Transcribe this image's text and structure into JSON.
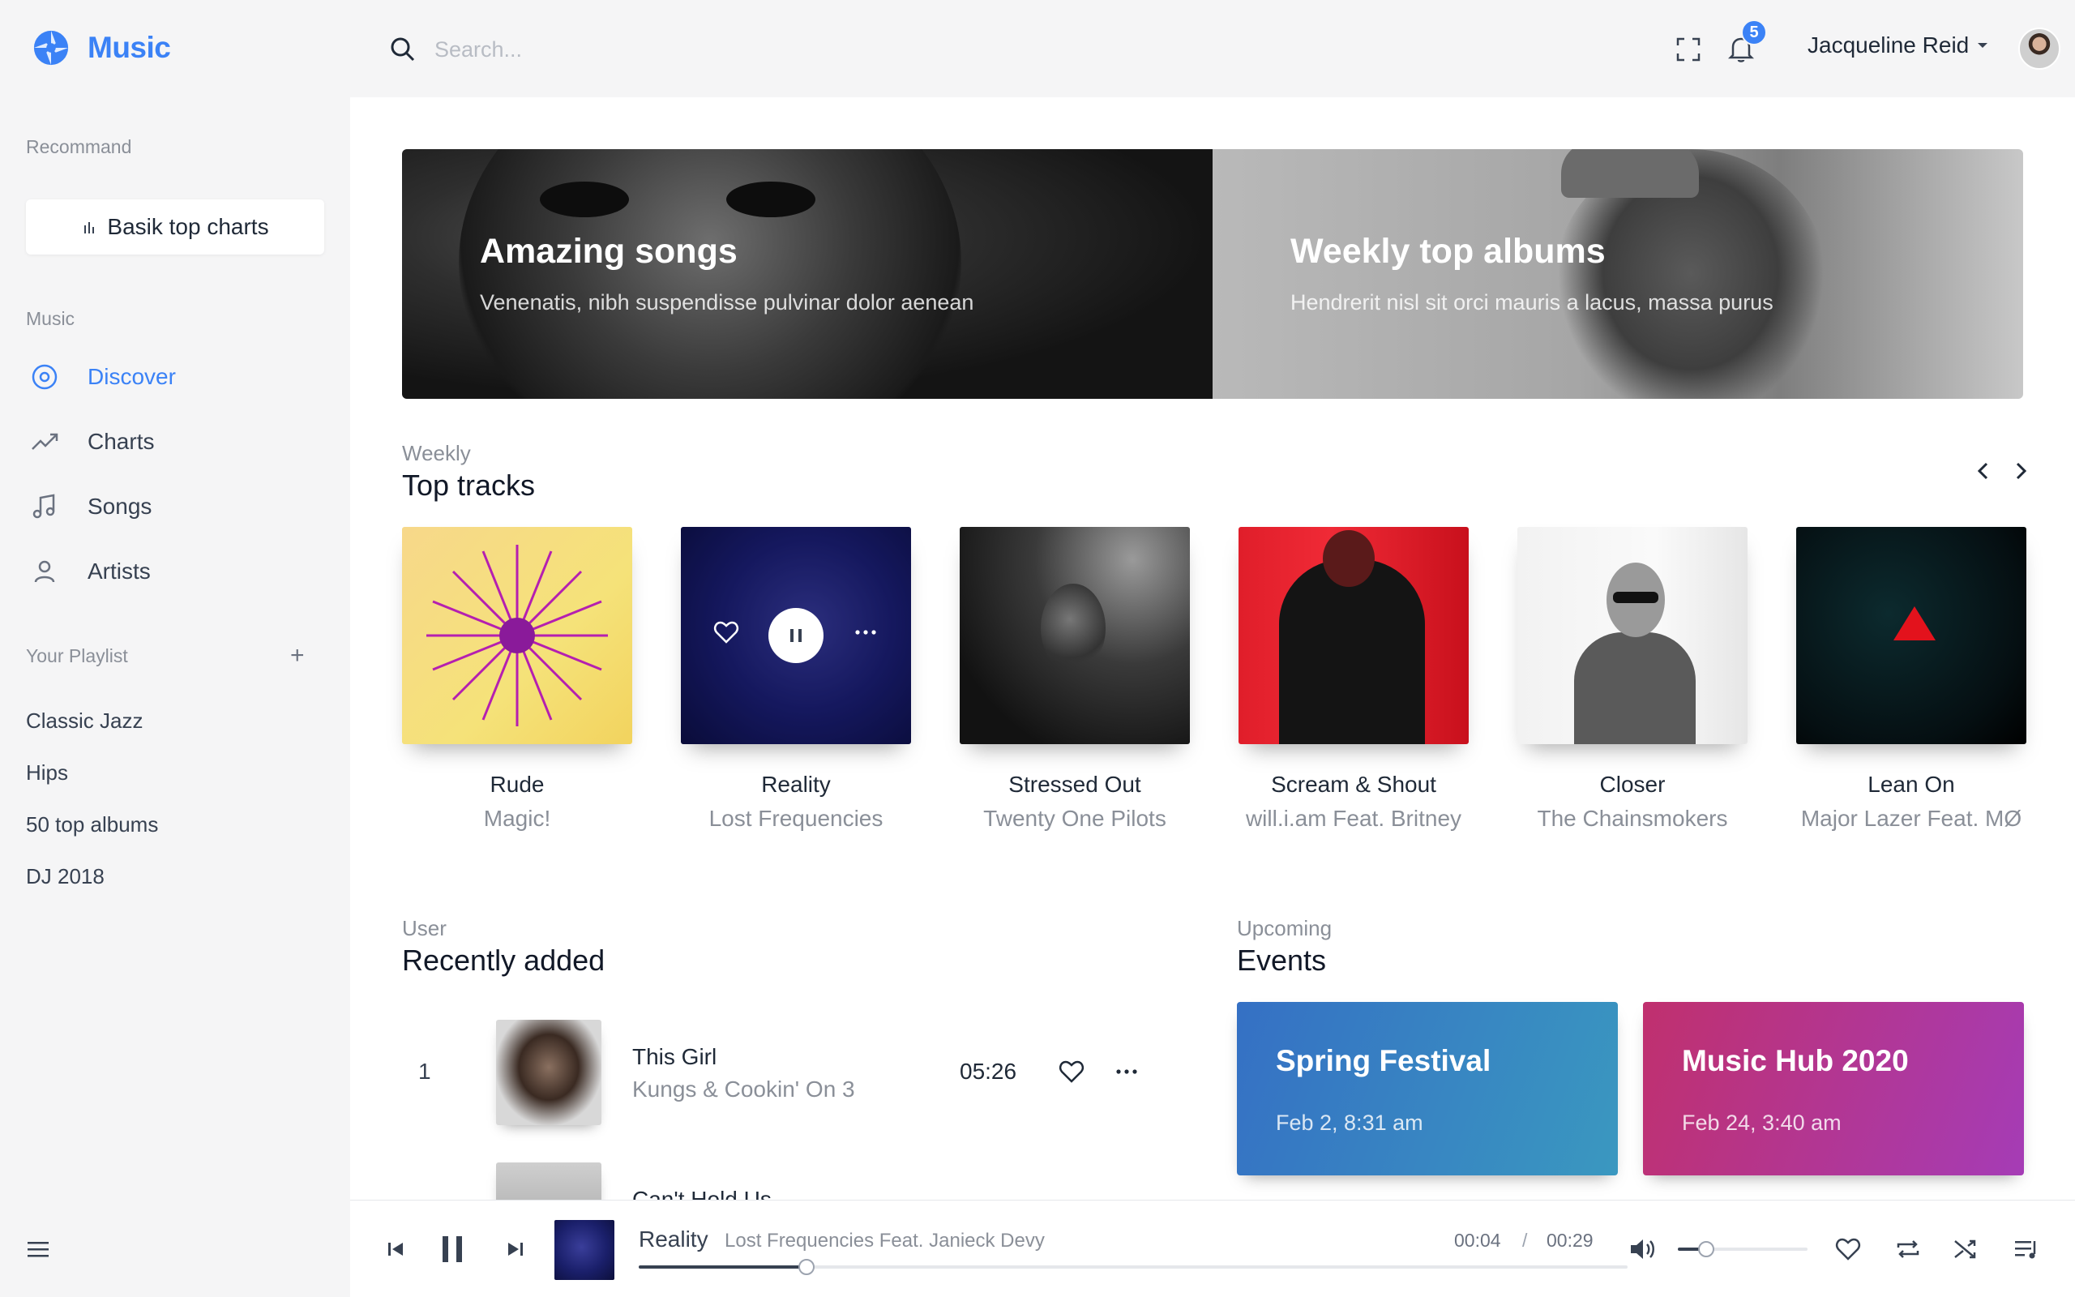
{
  "app": {
    "name": "Music"
  },
  "sidebar": {
    "section_recommend": "Recommand",
    "top_charts_button": "Basik top charts",
    "section_music": "Music",
    "nav": [
      {
        "label": "Discover",
        "icon": "disc-icon",
        "active": true
      },
      {
        "label": "Charts",
        "icon": "trending-icon",
        "active": false
      },
      {
        "label": "Songs",
        "icon": "music-note-icon",
        "active": false
      },
      {
        "label": "Artists",
        "icon": "user-icon",
        "active": false
      }
    ],
    "section_playlist": "Your Playlist",
    "add_label": "+",
    "playlists": [
      "Classic Jazz",
      "Hips",
      "50 top albums",
      "DJ 2018"
    ]
  },
  "topbar": {
    "search_placeholder": "Search...",
    "notifications_count": "5",
    "user_name": "Jacqueline Reid"
  },
  "banners": [
    {
      "title": "Amazing songs",
      "subtitle": "Venenatis, nibh suspendisse pulvinar dolor aenean"
    },
    {
      "title": "Weekly top albums",
      "subtitle": "Hendrerit nisl sit orci mauris a lacus, massa purus"
    }
  ],
  "top_tracks": {
    "kicker": "Weekly",
    "title": "Top tracks",
    "items": [
      {
        "title": "Rude",
        "artist": "Magic!"
      },
      {
        "title": "Reality",
        "artist": "Lost Frequencies"
      },
      {
        "title": "Stressed Out",
        "artist": "Twenty One Pilots"
      },
      {
        "title": "Scream & Shout",
        "artist": "will.i.am Feat. Britney"
      },
      {
        "title": "Closer",
        "artist": "The Chainsmokers"
      },
      {
        "title": "Lean On",
        "artist": "Major Lazer Feat. MØ"
      }
    ]
  },
  "recently_added": {
    "kicker": "User",
    "title": "Recently added",
    "rows": [
      {
        "num": "1",
        "title": "This Girl",
        "artist": "Kungs & Cookin' On 3",
        "duration": "05:26"
      },
      {
        "num": "",
        "title": "Can't Hold Us",
        "artist": "",
        "duration": ""
      }
    ]
  },
  "events": {
    "kicker": "Upcoming",
    "title": "Events",
    "items": [
      {
        "name": "Spring Festival",
        "date": "Feb 2, 8:31 am"
      },
      {
        "name": "Music Hub 2020",
        "date": "Feb 24, 3:40 am"
      }
    ]
  },
  "player": {
    "title": "Reality",
    "artist": "Lost Frequencies Feat. Janieck Devy",
    "current_time": "00:04",
    "separator": "/",
    "total_time": "00:29",
    "progress": 0.17,
    "volume": 0.22
  },
  "colors": {
    "accent": "#3b82f6",
    "sidebar_bg": "#f5f5f6",
    "event_1": "#3570c4",
    "event_2": "#c0306e"
  }
}
